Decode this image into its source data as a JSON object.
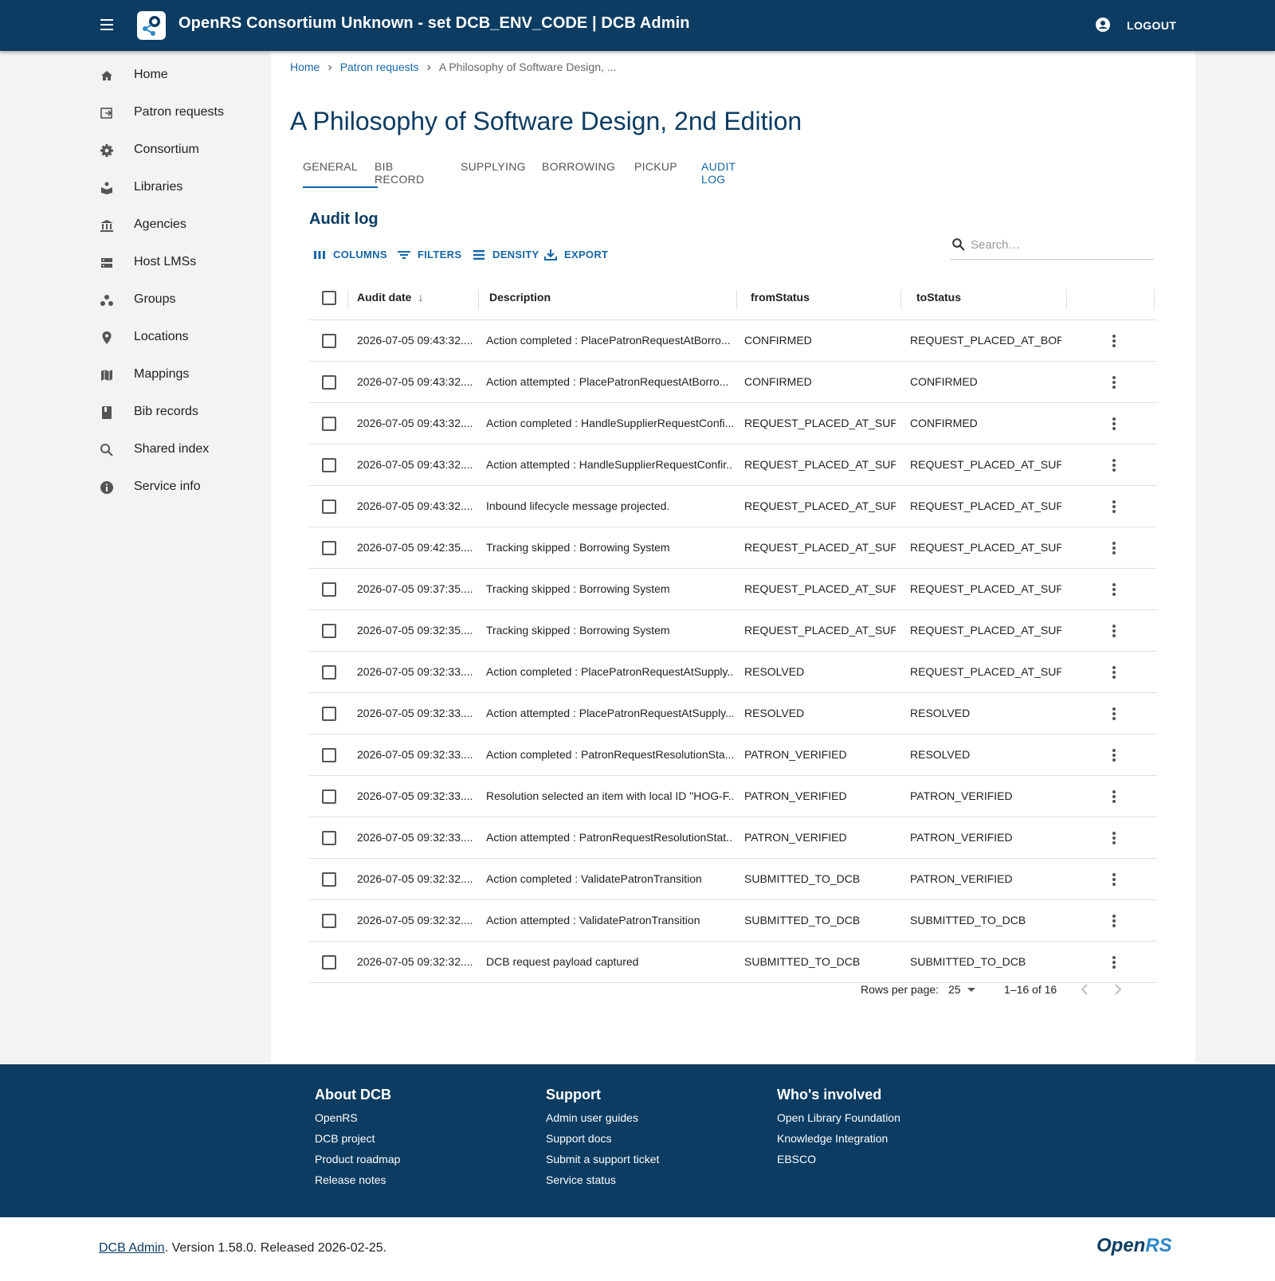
{
  "header": {
    "title": "OpenRS Consortium Unknown - set DCB_ENV_CODE | DCB Admin",
    "logout_label": "LOGOUT"
  },
  "sidebar": {
    "items": [
      {
        "label": "Home",
        "icon": "home-icon"
      },
      {
        "label": "Patron requests",
        "icon": "request-icon"
      },
      {
        "label": "Consortium",
        "icon": "settings-icon"
      },
      {
        "label": "Libraries",
        "icon": "library-icon"
      },
      {
        "label": "Agencies",
        "icon": "institution-icon"
      },
      {
        "label": "Host LMSs",
        "icon": "server-icon"
      },
      {
        "label": "Groups",
        "icon": "groups-icon"
      },
      {
        "label": "Locations",
        "icon": "location-pin-icon"
      },
      {
        "label": "Mappings",
        "icon": "map-icon"
      },
      {
        "label": "Bib records",
        "icon": "book-icon"
      },
      {
        "label": "Shared index",
        "icon": "search-icon"
      },
      {
        "label": "Service info",
        "icon": "info-icon"
      }
    ]
  },
  "breadcrumb": {
    "home": "Home",
    "patron_requests": "Patron requests",
    "current": "A Philosophy of Software Design, ..."
  },
  "page_title": "A Philosophy of Software Design, 2nd Edition",
  "tabs": [
    "GENERAL",
    "BIB RECORD",
    "SUPPLYING",
    "BORROWING",
    "PICKUP",
    "AUDIT LOG"
  ],
  "audit_log": {
    "title": "Audit log",
    "toolbar": {
      "columns": "COLUMNS",
      "filters": "FILTERS",
      "density": "DENSITY",
      "export": "EXPORT"
    },
    "search_placeholder": "Search…",
    "columns": {
      "audit_date": "Audit date",
      "description": "Description",
      "from_status": "fromStatus",
      "to_status": "toStatus"
    },
    "rows": [
      {
        "date": "2026-07-05 09:43:32....",
        "description": "Action completed : PlacePatronRequestAtBorro...",
        "from": "CONFIRMED",
        "to": "REQUEST_PLACED_AT_BOR..."
      },
      {
        "date": "2026-07-05 09:43:32....",
        "description": "Action attempted : PlacePatronRequestAtBorro...",
        "from": "CONFIRMED",
        "to": "CONFIRMED"
      },
      {
        "date": "2026-07-05 09:43:32....",
        "description": "Action completed : HandleSupplierRequestConfi...",
        "from": "REQUEST_PLACED_AT_SUP...",
        "to": "CONFIRMED"
      },
      {
        "date": "2026-07-05 09:43:32....",
        "description": "Action attempted : HandleSupplierRequestConfir...",
        "from": "REQUEST_PLACED_AT_SUP...",
        "to": "REQUEST_PLACED_AT_SUP..."
      },
      {
        "date": "2026-07-05 09:43:32....",
        "description": "Inbound lifecycle message projected.",
        "from": "REQUEST_PLACED_AT_SUP...",
        "to": "REQUEST_PLACED_AT_SUP..."
      },
      {
        "date": "2026-07-05 09:42:35....",
        "description": "Tracking skipped : Borrowing System",
        "from": "REQUEST_PLACED_AT_SUP...",
        "to": "REQUEST_PLACED_AT_SUP..."
      },
      {
        "date": "2026-07-05 09:37:35....",
        "description": "Tracking skipped : Borrowing System",
        "from": "REQUEST_PLACED_AT_SUP...",
        "to": "REQUEST_PLACED_AT_SUP..."
      },
      {
        "date": "2026-07-05 09:32:35....",
        "description": "Tracking skipped : Borrowing System",
        "from": "REQUEST_PLACED_AT_SUP...",
        "to": "REQUEST_PLACED_AT_SUP..."
      },
      {
        "date": "2026-07-05 09:32:33....",
        "description": "Action completed : PlacePatronRequestAtSupply...",
        "from": "RESOLVED",
        "to": "REQUEST_PLACED_AT_SUP..."
      },
      {
        "date": "2026-07-05 09:32:33....",
        "description": "Action attempted : PlacePatronRequestAtSupply...",
        "from": "RESOLVED",
        "to": "RESOLVED"
      },
      {
        "date": "2026-07-05 09:32:33....",
        "description": "Action completed : PatronRequestResolutionSta...",
        "from": "PATRON_VERIFIED",
        "to": "RESOLVED"
      },
      {
        "date": "2026-07-05 09:32:33....",
        "description": "Resolution selected an item with local ID \"HOG-F...",
        "from": "PATRON_VERIFIED",
        "to": "PATRON_VERIFIED"
      },
      {
        "date": "2026-07-05 09:32:33....",
        "description": "Action attempted : PatronRequestResolutionStat...",
        "from": "PATRON_VERIFIED",
        "to": "PATRON_VERIFIED"
      },
      {
        "date": "2026-07-05 09:32:32....",
        "description": "Action completed : ValidatePatronTransition",
        "from": "SUBMITTED_TO_DCB",
        "to": "PATRON_VERIFIED"
      },
      {
        "date": "2026-07-05 09:32:32....",
        "description": "Action attempted : ValidatePatronTransition",
        "from": "SUBMITTED_TO_DCB",
        "to": "SUBMITTED_TO_DCB"
      },
      {
        "date": "2026-07-05 09:32:32....",
        "description": "DCB request payload captured",
        "from": "SUBMITTED_TO_DCB",
        "to": "SUBMITTED_TO_DCB"
      }
    ],
    "pagination": {
      "rows_per_page_label": "Rows per page:",
      "rows_per_page": "25",
      "range": "1–16 of 16"
    }
  },
  "footer": {
    "about": {
      "title": "About DCB",
      "links": [
        "OpenRS",
        "DCB project",
        "Product roadmap",
        "Release notes"
      ]
    },
    "support": {
      "title": "Support",
      "links": [
        "Admin user guides",
        "Support docs",
        "Submit a support ticket",
        "Service status"
      ]
    },
    "involved": {
      "title": "Who's involved",
      "links": [
        "Open Library Foundation",
        "Knowledge Integration",
        "EBSCO"
      ]
    }
  },
  "version": {
    "app_link": "DCB Admin",
    "text": ". Version 1.58.0. Released 2026-02-25."
  },
  "brand": {
    "open": "Open",
    "rs": "RS"
  },
  "colors": {
    "primary": "#0c3c62",
    "accent": "#1565a8"
  }
}
